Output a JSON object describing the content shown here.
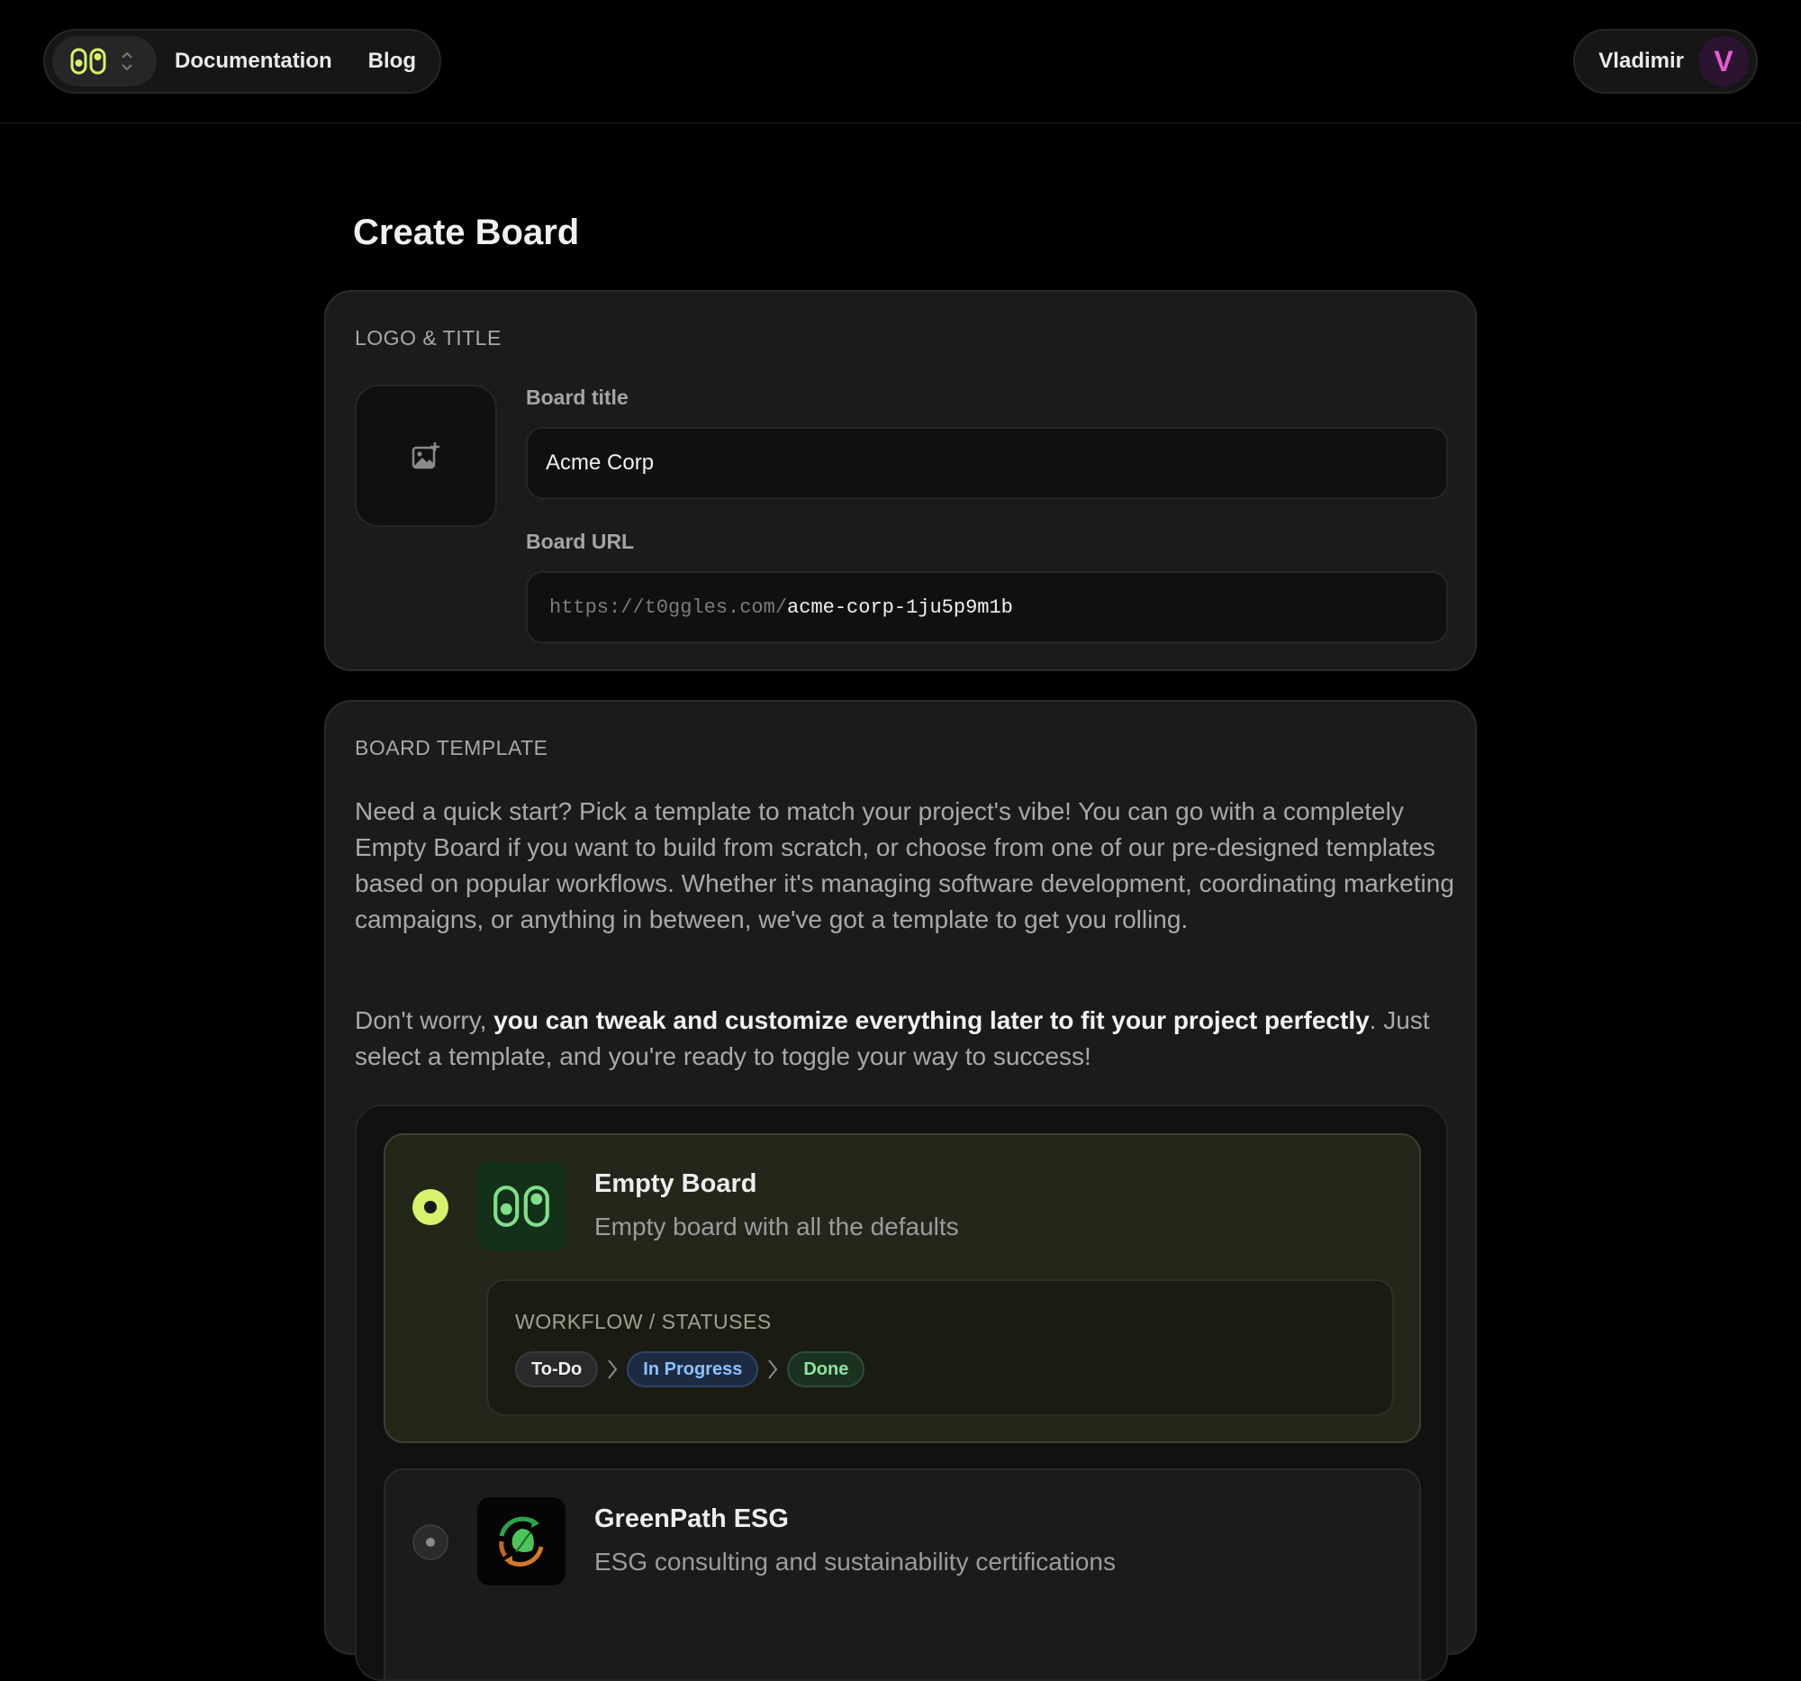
{
  "nav": {
    "links": [
      "Documentation",
      "Blog"
    ]
  },
  "user": {
    "name": "Vladimir",
    "initial": "V"
  },
  "page": {
    "title": "Create Board"
  },
  "logo_section": {
    "label": "LOGO & TITLE",
    "title_label": "Board title",
    "title_value": "Acme Corp",
    "url_label": "Board URL",
    "url_prefix": "https://t0ggles.com/",
    "url_slug": "acme-corp-1ju5p9m1b"
  },
  "template_section": {
    "label": "BOARD TEMPLATE",
    "paragraph1": "Need a quick start? Pick a template to match your project's vibe! You can go with a completely Empty Board if you want to build from scratch, or choose from one of our pre-designed templates based on popular workflows. Whether it's managing software development, coordinating marketing campaigns, or anything in between, we've got a template to get you rolling.",
    "paragraph2_start": "Don't worry, ",
    "paragraph2_bold": "you can tweak and customize everything later to fit your project perfectly",
    "paragraph2_end": ". Just select a template, and you're ready to toggle your way to success!",
    "templates": [
      {
        "name": "Empty Board",
        "description": "Empty board with all the defaults",
        "selected": true,
        "icon": "t0ggles-logo-icon",
        "workflow_label": "WORKFLOW / STATUSES",
        "statuses": [
          "To-Do",
          "In Progress",
          "Done"
        ]
      },
      {
        "name": "GreenPath ESG",
        "description": "ESG consulting and sustainability certifications",
        "selected": false,
        "icon": "leaf-recycle-icon"
      }
    ]
  },
  "colors": {
    "accent": "#d7f26b",
    "avatar": "#e45bd2",
    "in_progress": "#8cc2ff",
    "done": "#8fe39f"
  }
}
